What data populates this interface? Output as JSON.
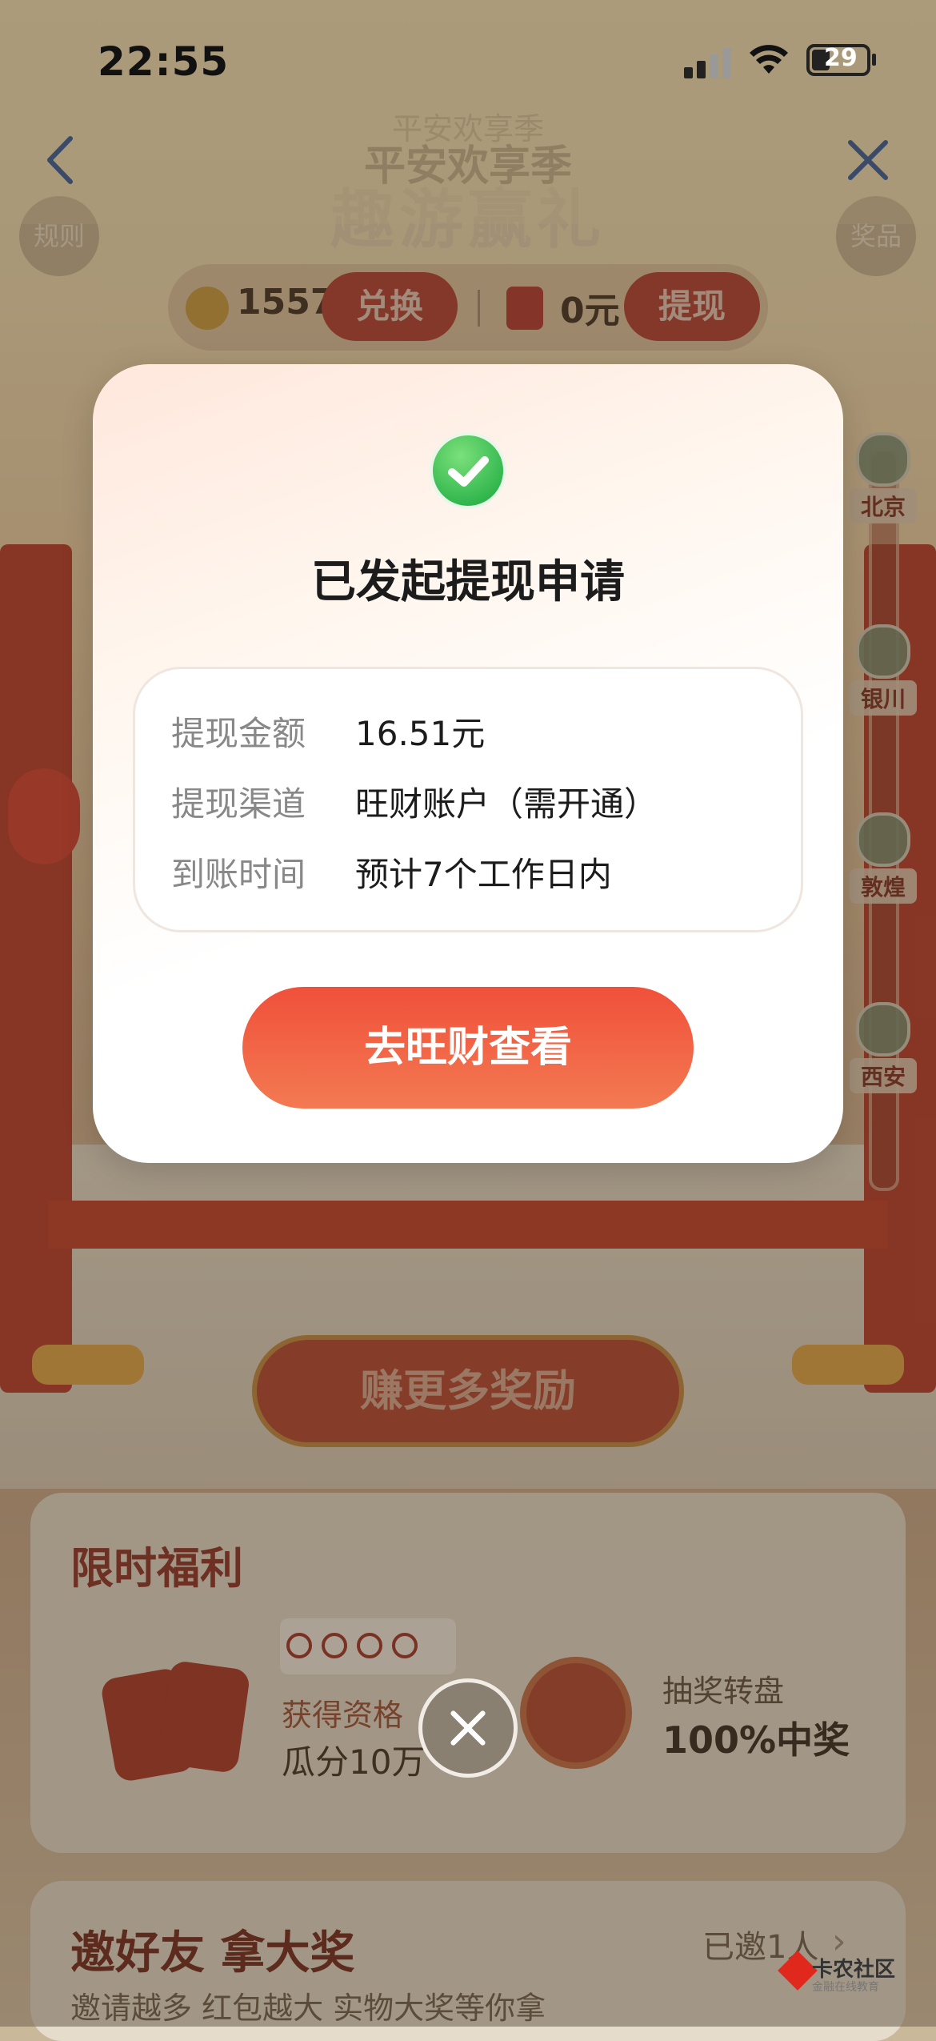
{
  "status_bar": {
    "time": "22:55",
    "battery": "29"
  },
  "nav": {
    "title_small": "平安欢享季",
    "title": "平安欢享季",
    "big_title": "趣游赢礼",
    "rules_label": "规则",
    "prizes_label": "奖品"
  },
  "balance": {
    "coins": "1557",
    "exchange_label": "兑换",
    "cash": "0元",
    "withdraw_label": "提现"
  },
  "cities": [
    "北京",
    "银川",
    "敦煌",
    "西安"
  ],
  "earn_button": "赚更多奖励",
  "welfare": {
    "title": "限时福利",
    "qualification_label": "获得资格",
    "qualification_value": "瓜分10万",
    "wheel_label": "抽奖转盘",
    "wheel_value": "100%中奖"
  },
  "invite": {
    "title": "邀好友 拿大奖",
    "subtitle": "邀请越多 红包越大 实物大奖等你拿",
    "invited": "已邀1人"
  },
  "watermark": {
    "text": "卡农社区",
    "sub": "金融在线教育"
  },
  "modal": {
    "title": "已发起提现申请",
    "rows": [
      {
        "key": "提现金额",
        "value": "16.51元"
      },
      {
        "key": "提现渠道",
        "value": "旺财账户（需开通）"
      },
      {
        "key": "到账时间",
        "value": "预计7个工作日内"
      }
    ],
    "button": "去旺财查看",
    "accent": "#f0503a"
  }
}
